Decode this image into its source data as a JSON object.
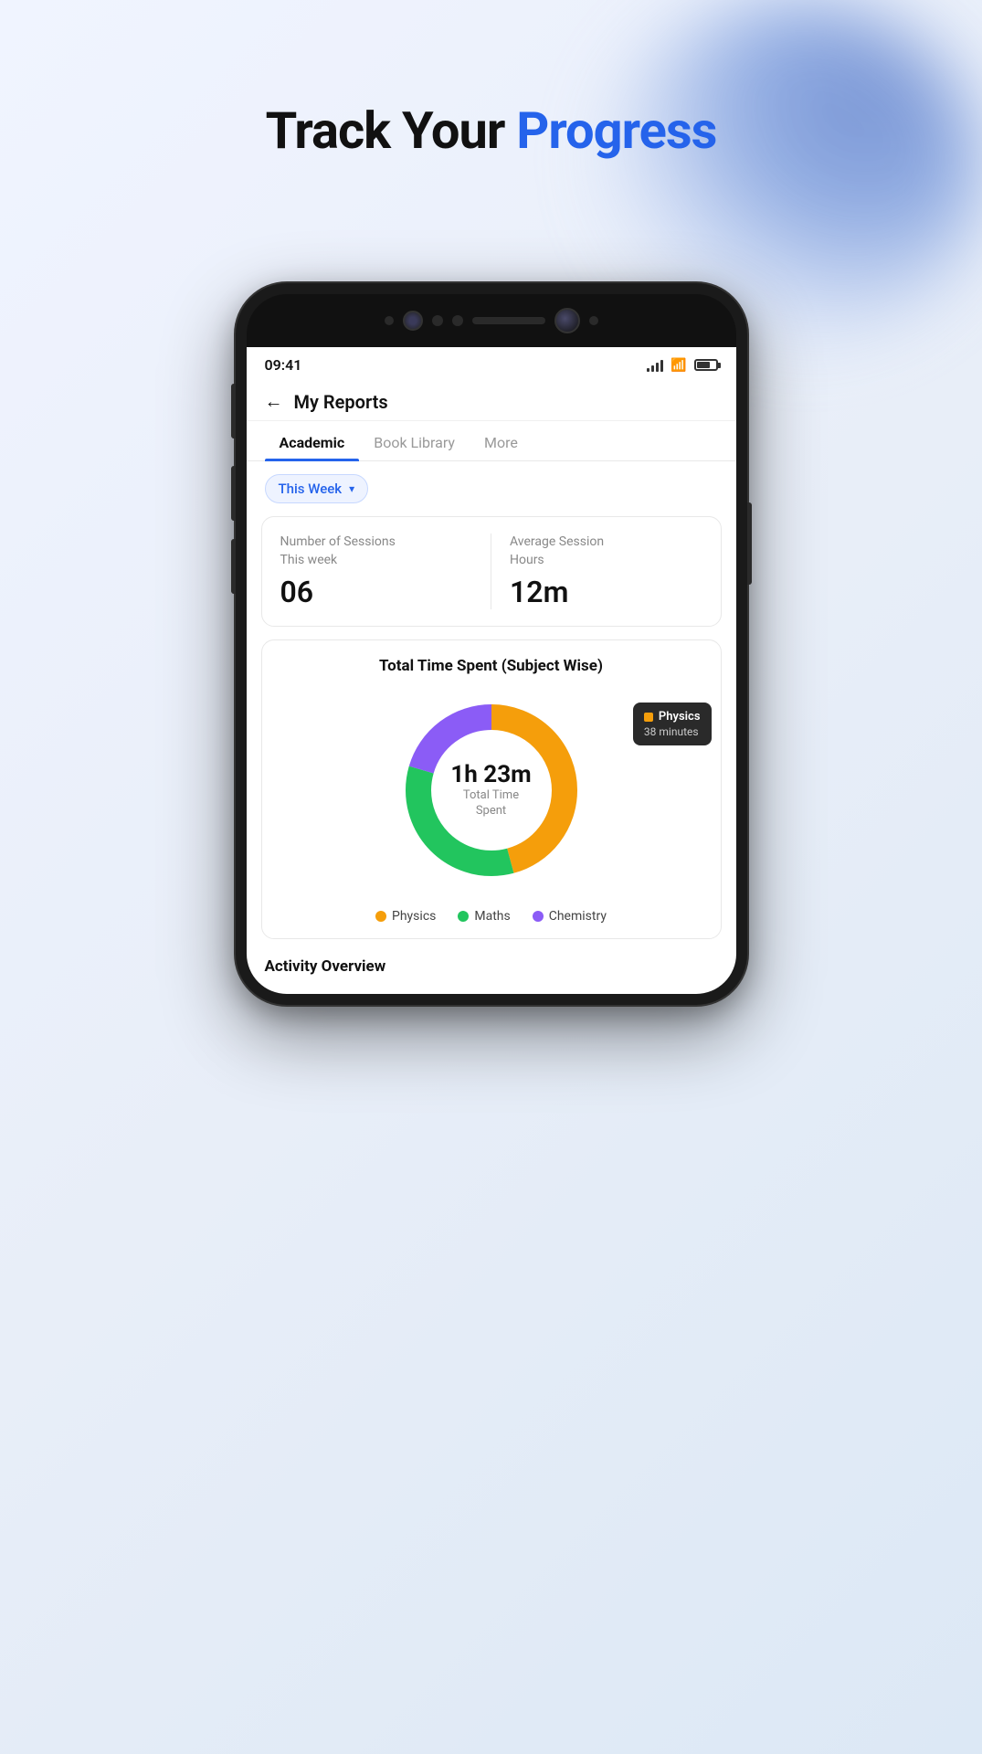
{
  "page": {
    "title_plain": "Track Your ",
    "title_highlight": "Progress"
  },
  "status_bar": {
    "time": "09:41",
    "signal_label": "signal",
    "wifi_label": "wifi",
    "battery_label": "battery"
  },
  "app_header": {
    "back_label": "←",
    "title": "My Reports"
  },
  "tabs": [
    {
      "label": "Academic",
      "active": true
    },
    {
      "label": "Book Library",
      "active": false
    },
    {
      "label": "More",
      "active": false
    }
  ],
  "filter": {
    "label": "This Week",
    "chevron": "▾"
  },
  "stats": {
    "sessions_label": "Number of Sessions\nThis week",
    "sessions_value": "06",
    "avg_label": "Average Session\nHours",
    "avg_value": "12m"
  },
  "chart_section": {
    "title": "Total Time Spent (Subject Wise)",
    "donut": {
      "total_time": "1h 23m",
      "total_label": "Total Time\nSpent",
      "segments": [
        {
          "subject": "Physics",
          "color": "#f59e0b",
          "minutes": 38,
          "percentage": 45
        },
        {
          "subject": "Maths",
          "color": "#22c55e",
          "minutes": 28,
          "percentage": 33
        },
        {
          "subject": "Chemistry",
          "color": "#8b5cf6",
          "minutes": 17,
          "percentage": 22
        }
      ]
    },
    "tooltip": {
      "subject": "Physics",
      "minutes": "38 minutes"
    },
    "legend": [
      {
        "label": "Physics",
        "color": "#f59e0b"
      },
      {
        "label": "Maths",
        "color": "#22c55e"
      },
      {
        "label": "Chemistry",
        "color": "#8b5cf6"
      }
    ]
  },
  "activity": {
    "title": "Activity Overview"
  }
}
